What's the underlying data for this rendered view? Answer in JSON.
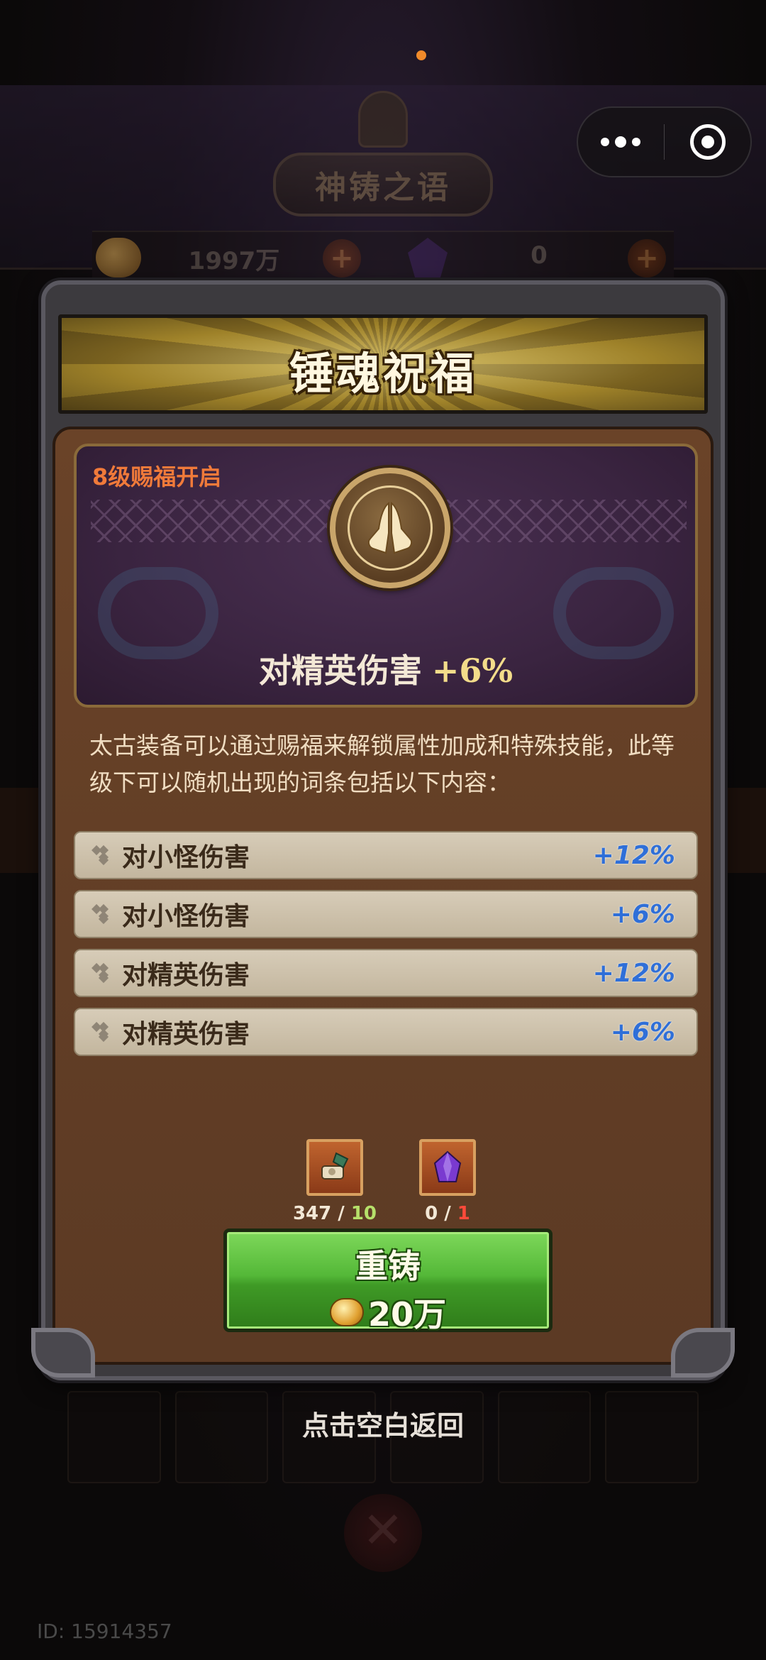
{
  "background": {
    "title": "神铸之语",
    "gold_amount": "1997万",
    "gem_amount": "0",
    "plus_symbol": "+"
  },
  "capsule": {
    "more_icon": "more-dots-icon",
    "close_icon": "target-close-icon"
  },
  "panel": {
    "title": "锤魂祝福",
    "blessing": {
      "level_tag": "8级赐福开启",
      "stat_name": "对精英伤害",
      "stat_value": "+6%"
    },
    "description": "太古装备可以通过赐福来解锁属性加成和特殊技能，此等级下可以随机出现的词条包括以下内容：",
    "possible_stats": [
      {
        "name": "对小怪伤害",
        "value": "+12%"
      },
      {
        "name": "对小怪伤害",
        "value": "+6%"
      },
      {
        "name": "对精英伤害",
        "value": "+12%"
      },
      {
        "name": "对精英伤害",
        "value": "+6%"
      }
    ],
    "costs": [
      {
        "icon": "hammer-scroll-icon",
        "have": "347",
        "need": "10",
        "sep": " / "
      },
      {
        "icon": "purple-crystal-icon",
        "have": "0",
        "need": "1",
        "sep": " / "
      }
    ],
    "reforge_button": {
      "label": "重铸",
      "cost": "20万"
    }
  },
  "back_hint": "点击空白返回",
  "id_label": "ID: 15914357",
  "colors": {
    "accent_orange": "#f07a3a",
    "percent_blue": "#2f6fd8",
    "button_green": "#54b838",
    "need_ok": "#b6e06a",
    "need_bad": "#ff4a3a"
  }
}
